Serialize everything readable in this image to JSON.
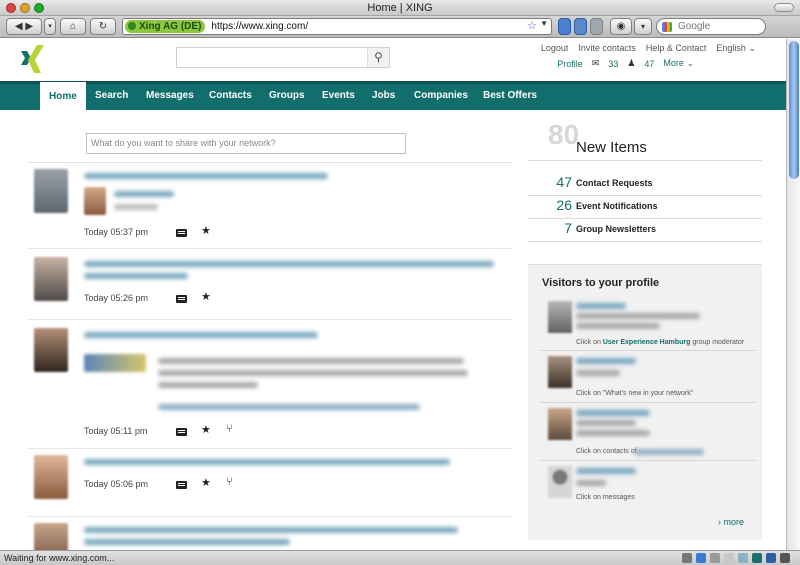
{
  "window": {
    "title": "Home | XING"
  },
  "browser": {
    "site_badge": "Xing AG (DE)",
    "url": "https://www.xing.com/",
    "search_placeholder": "Google",
    "status": "Waiting for www.xing.com..."
  },
  "header": {
    "util_links": [
      "Logout",
      "Invite contacts",
      "Help & Contact",
      "English"
    ],
    "profile_label": "Profile",
    "messages_count": "33",
    "contacts_count": "47",
    "more_label": "More"
  },
  "nav": {
    "items": [
      "Home",
      "Search",
      "Messages",
      "Contacts",
      "Groups",
      "Events",
      "Jobs",
      "Companies",
      "Best Offers"
    ]
  },
  "feed": {
    "share_placeholder": "What do you want to share with your network?",
    "items": [
      {
        "time": "Today 05:37 pm"
      },
      {
        "time": "Today 05:26 pm"
      },
      {
        "time": "Today 05:11 pm"
      },
      {
        "time": "Today 05:06 pm"
      }
    ]
  },
  "new_items": {
    "total": "80",
    "title": "New Items",
    "rows": [
      {
        "count": "47",
        "label": "Contact Requests"
      },
      {
        "count": "26",
        "label": "Event Notifications"
      },
      {
        "count": "7",
        "label": "Group Newsletters"
      }
    ]
  },
  "visitors": {
    "title": "Visitors to your profile",
    "items": [
      {
        "click_prefix": "Click on",
        "click_target": "User Experience Hamburg",
        "click_suffix": "group moderator"
      },
      {
        "click_text": "Click on \"What's new in your network\""
      },
      {
        "click_text": "Click on contacts of"
      },
      {
        "click_text": "Click on messages"
      }
    ],
    "more_label": "more"
  },
  "colors": {
    "brand_teal": "#126e6c",
    "brand_green": "#b8d433"
  }
}
